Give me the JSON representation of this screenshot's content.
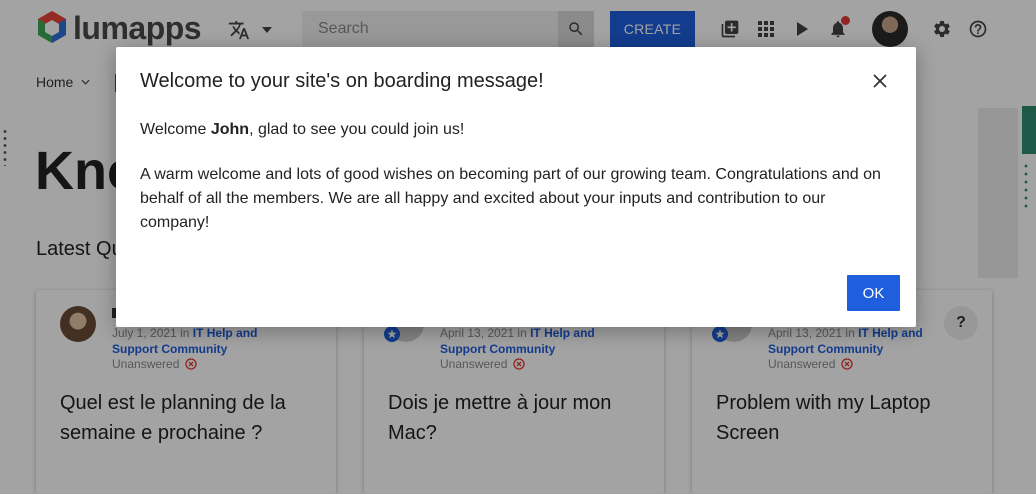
{
  "header": {
    "logo_text": "lumapps",
    "search": {
      "placeholder": "Search"
    },
    "create_label": "CREATE"
  },
  "nav": {
    "home_label": "Home"
  },
  "page": {
    "title": "Knowledge",
    "section_title": "Latest Questions"
  },
  "cards": [
    {
      "date": "July 1, 2021",
      "in_label": "in",
      "community": "IT Help and Support Community",
      "status": "Unanswered",
      "question": "Quel est le planning de la semaine e prochaine ?"
    },
    {
      "date": "April 13, 2021",
      "in_label": "in",
      "community": "IT Help and Support Community",
      "status": "Unanswered",
      "question": "Dois je mettre à jour mon Mac?"
    },
    {
      "date": "April 13, 2021",
      "in_label": "in",
      "community": "IT Help and Support Community",
      "status": "Unanswered",
      "question": "Problem with my Laptop Screen",
      "menu_label": "?"
    }
  ],
  "modal": {
    "title": "Welcome to your site's on boarding message!",
    "greeting_prefix": "Welcome ",
    "greeting_name": "John",
    "greeting_suffix": ", glad to see you could join us!",
    "body": "A warm welcome and lots of good wishes on becoming part of our growing team. Congratulations and on behalf of all the members. We are all happy and excited about your inputs and contribution to our company!",
    "ok_label": "OK"
  },
  "colors": {
    "accent": "#1f5fde",
    "overlay": "rgba(0,0,0,0.36)",
    "status_red": "#e53935",
    "decor_green": "#2e8b6e"
  },
  "icons": [
    "translate-icon",
    "search-icon",
    "library-icon",
    "apps-grid-icon",
    "play-icon",
    "bell-icon",
    "settings-icon",
    "help-icon",
    "close-icon",
    "star-icon",
    "unanswered-icon"
  ]
}
